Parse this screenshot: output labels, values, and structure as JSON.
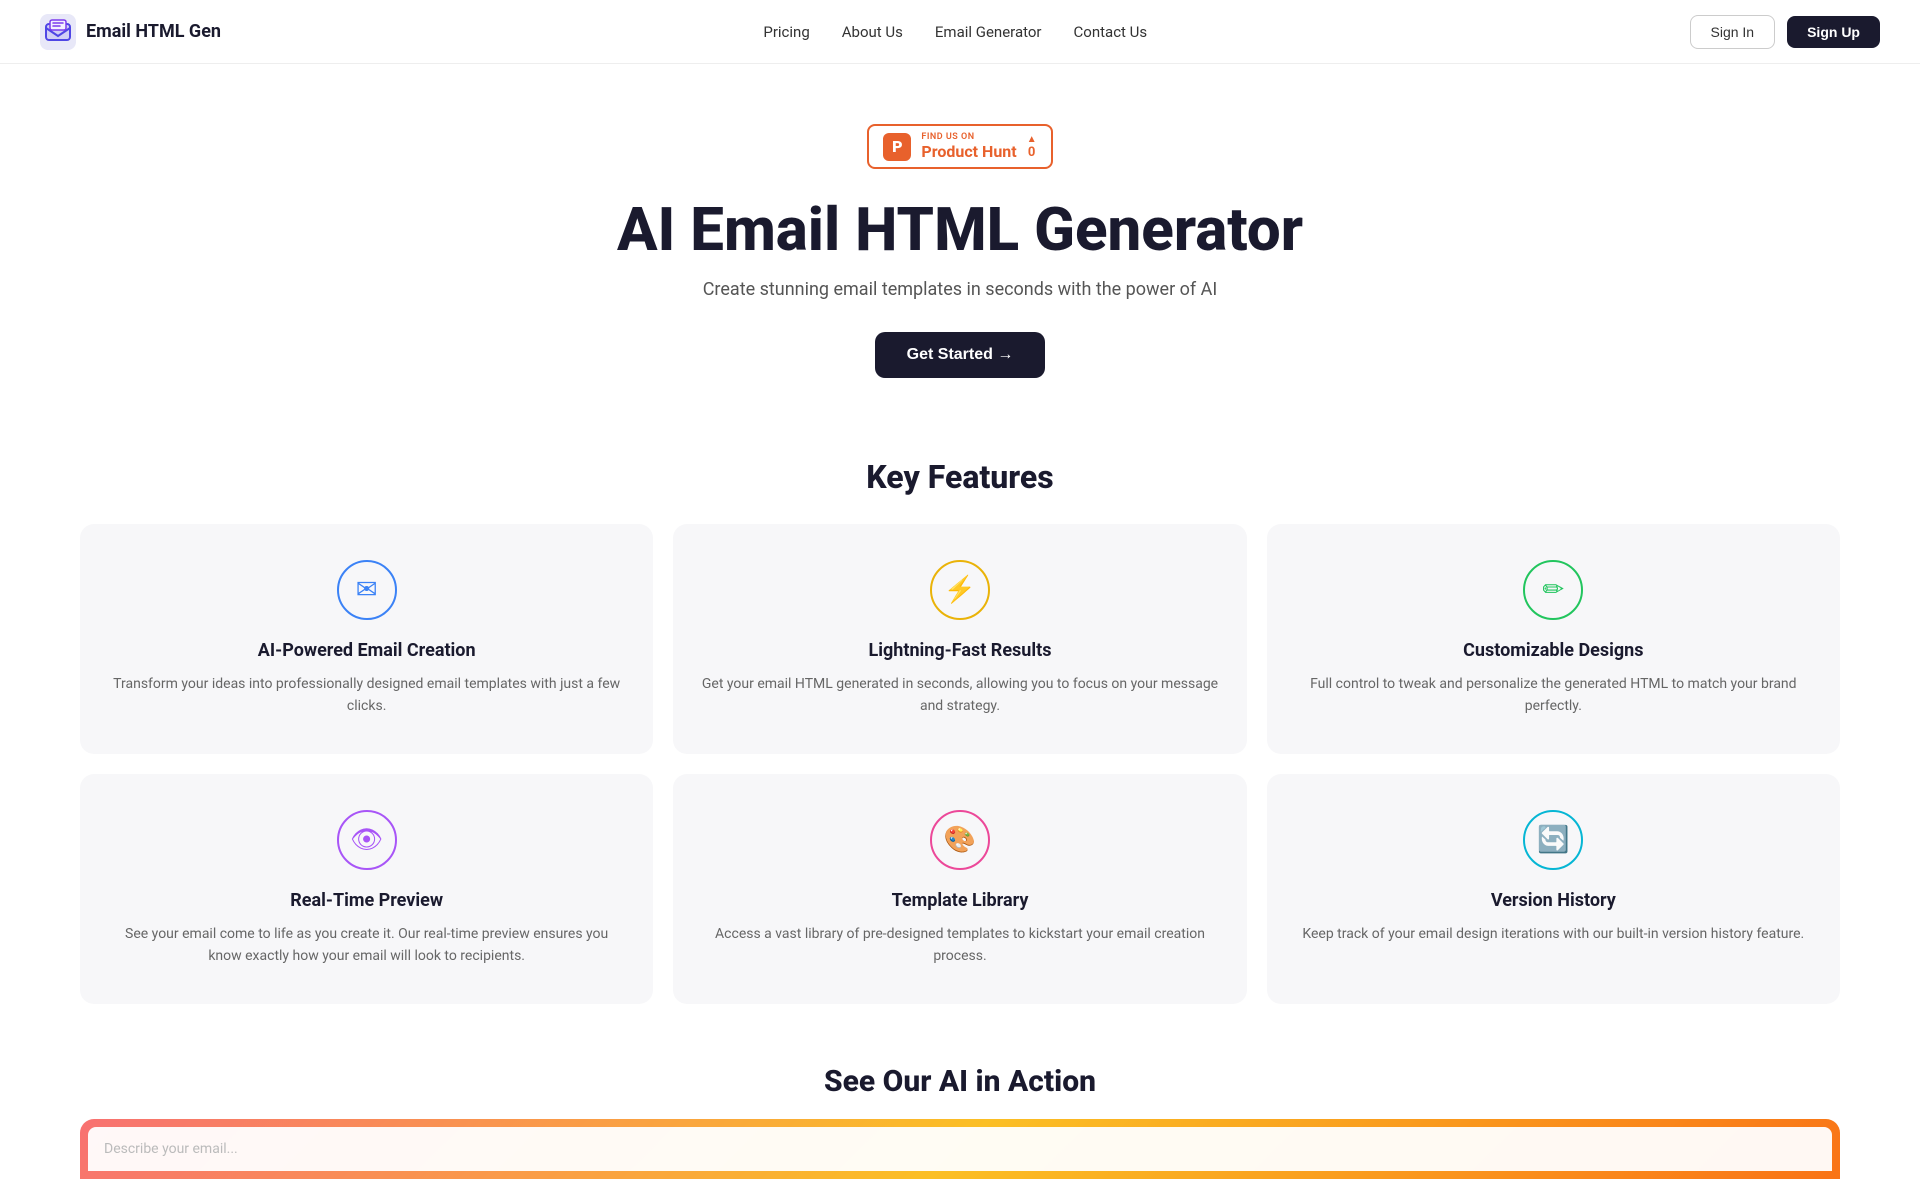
{
  "brand": {
    "name": "Email HTML Gen",
    "logo_unicode": "📧"
  },
  "navbar": {
    "links": [
      {
        "id": "pricing",
        "label": "Pricing"
      },
      {
        "id": "about",
        "label": "About Us"
      },
      {
        "id": "generator",
        "label": "Email Generator"
      },
      {
        "id": "contact",
        "label": "Contact Us"
      }
    ],
    "signin_label": "Sign In",
    "signup_label": "Sign Up"
  },
  "product_hunt": {
    "find_us_text": "FIND US ON",
    "name": "Product Hunt",
    "logo_letter": "P",
    "vote_arrow": "▲",
    "vote_count": "0"
  },
  "hero": {
    "title": "AI Email HTML Generator",
    "subtitle": "Create stunning email templates in seconds with the power of AI",
    "cta_label": "Get Started →"
  },
  "features": {
    "section_title": "Key Features",
    "cards": [
      {
        "id": "ai-creation",
        "icon": "✉",
        "icon_style": "blue",
        "title": "AI-Powered Email Creation",
        "description": "Transform your ideas into professionally designed email templates with just a few clicks."
      },
      {
        "id": "fast-results",
        "icon": "⚡",
        "icon_style": "yellow",
        "title": "Lightning-Fast Results",
        "description": "Get your email HTML generated in seconds, allowing you to focus on your message and strategy."
      },
      {
        "id": "customizable",
        "icon": "✏",
        "icon_style": "green",
        "title": "Customizable Designs",
        "description": "Full control to tweak and personalize the generated HTML to match your brand perfectly."
      },
      {
        "id": "preview",
        "icon": "👁",
        "icon_style": "purple",
        "title": "Real-Time Preview",
        "description": "See your email come to life as you create it. Our real-time preview ensures you know exactly how your email will look to recipients."
      },
      {
        "id": "library",
        "icon": "🎨",
        "icon_style": "pink",
        "title": "Template Library",
        "description": "Access a vast library of pre-designed templates to kickstart your email creation process."
      },
      {
        "id": "history",
        "icon": "🔄",
        "icon_style": "blue2",
        "title": "Version History",
        "description": "Keep track of your email design iterations with our built-in version history feature."
      }
    ]
  },
  "ai_action": {
    "section_title": "See Our AI in Action",
    "demo_placeholder": "Describe your email..."
  }
}
